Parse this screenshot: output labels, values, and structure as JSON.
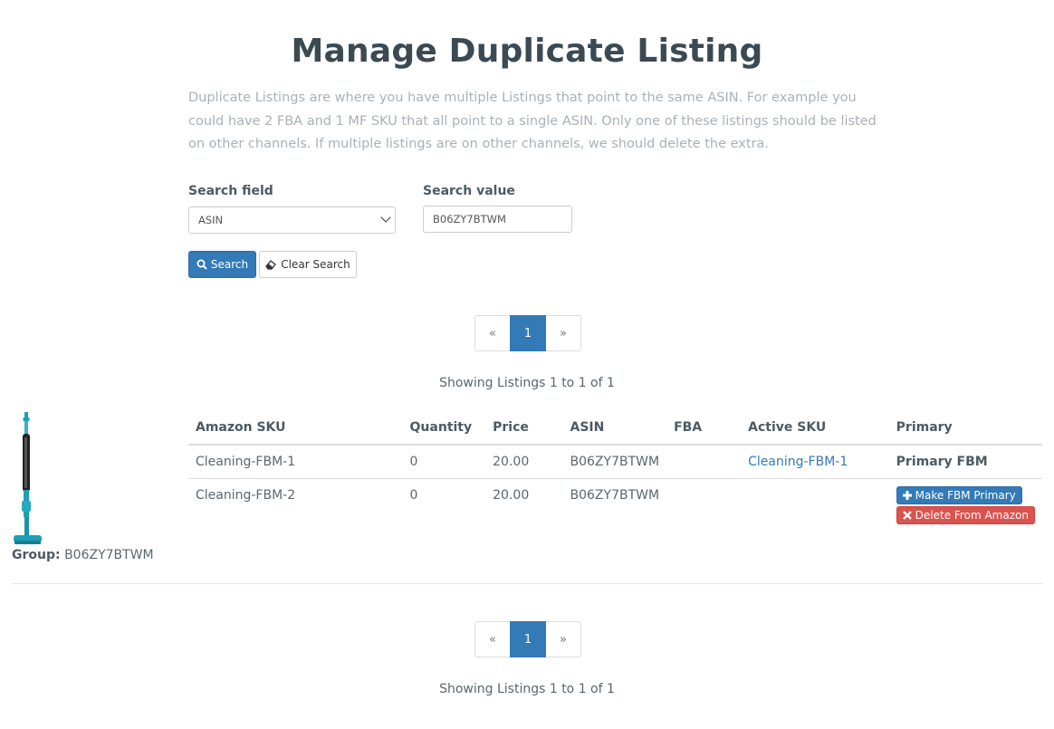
{
  "page": {
    "title": "Manage Duplicate Listing",
    "intro": "Duplicate Listings are where you have multiple Listings that point to the same ASIN. For example you could have 2 FBA and 1 MF SKU that all point to a single ASIN. Only one of these listings should be listed on other channels. If multiple listings are on other channels, we should delete the extra."
  },
  "search": {
    "field_label": "Search field",
    "field_value": "ASIN",
    "value_label": "Search value",
    "value": "B06ZY7BTWM",
    "search_button": "Search",
    "clear_button": "Clear Search"
  },
  "pagination": {
    "prev": "«",
    "current": "1",
    "next": "»",
    "showing": "Showing Listings 1 to 1 of 1"
  },
  "group": {
    "label": "Group:",
    "value": "B06ZY7BTWM"
  },
  "table": {
    "headers": [
      "Amazon SKU",
      "Quantity",
      "Price",
      "ASIN",
      "FBA",
      "Active SKU",
      "Primary"
    ],
    "rows": [
      {
        "sku": "Cleaning-FBM-1",
        "quantity": "0",
        "price": "20.00",
        "asin": "B06ZY7BTWM",
        "fba": "",
        "active_sku": "Cleaning-FBM-1",
        "primary": "Primary FBM"
      },
      {
        "sku": "Cleaning-FBM-2",
        "quantity": "0",
        "price": "20.00",
        "asin": "B06ZY7BTWM",
        "fba": "",
        "active_sku": "",
        "make_primary_button": "Make FBM Primary",
        "delete_button": "Delete From Amazon"
      }
    ]
  },
  "colors": {
    "primary": "#337ab7",
    "danger": "#d9534f",
    "product": "#1f9fb5"
  },
  "icons": [
    "search-icon",
    "eraser-icon",
    "plus-icon",
    "times-icon",
    "chevron-down-icon"
  ]
}
